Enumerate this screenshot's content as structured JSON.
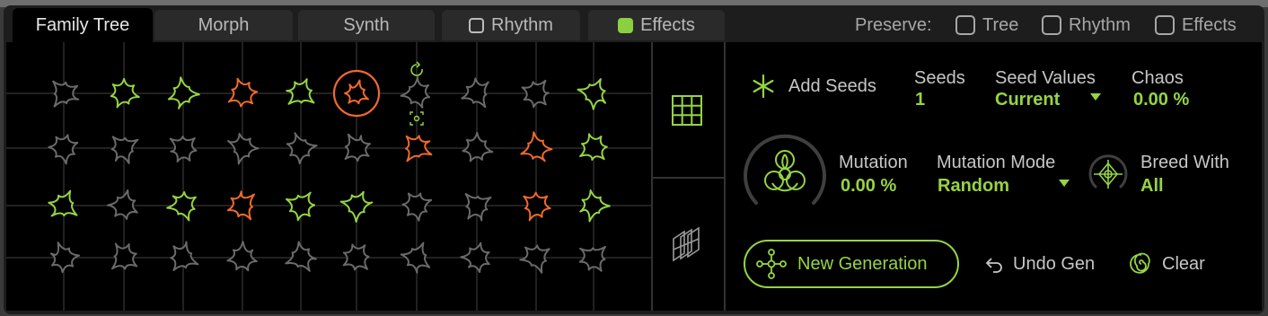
{
  "tabs": [
    {
      "label": "Family Tree",
      "active": true
    },
    {
      "label": "Morph",
      "active": false
    },
    {
      "label": "Synth",
      "active": false
    },
    {
      "label": "Rhythm",
      "active": false,
      "checkbox": false
    },
    {
      "label": "Effects",
      "active": false,
      "checkbox": true
    }
  ],
  "preserve": {
    "label": "Preserve:",
    "options": [
      {
        "label": "Tree",
        "checked": false
      },
      {
        "label": "Rhythm",
        "checked": false
      },
      {
        "label": "Effects",
        "checked": false
      }
    ]
  },
  "colors": {
    "accent": "#95d444",
    "highlight": "#f06a2d",
    "inactive": "#6a6a6a"
  },
  "tree": {
    "rows": [
      [
        "gray",
        "green",
        "green",
        "orange",
        "green",
        "selected",
        "gray",
        "gray",
        "gray",
        "green"
      ],
      [
        "gray",
        "gray",
        "gray",
        "gray",
        "gray",
        "gray",
        "orange",
        "gray",
        "orange",
        "green"
      ],
      [
        "green",
        "gray",
        "green",
        "orange",
        "green",
        "green",
        "gray",
        "gray",
        "orange",
        "green"
      ],
      [
        "gray",
        "gray",
        "gray",
        "gray",
        "gray",
        "gray",
        "gray",
        "gray",
        "gray",
        "gray"
      ]
    ]
  },
  "view_buttons": [
    {
      "icon": "grid-icon",
      "active": true
    },
    {
      "icon": "layers-icon",
      "active": false
    }
  ],
  "controls": {
    "add_seeds": "Add Seeds",
    "seeds_label": "Seeds",
    "seeds_value": "1",
    "seed_values_label": "Seed Values",
    "seed_values_value": "Current",
    "chaos_label": "Chaos",
    "chaos_value": "0.00 %",
    "mutation_label": "Mutation",
    "mutation_value": "0.00 %",
    "mutation_mode_label": "Mutation Mode",
    "mutation_mode_value": "Random",
    "breed_with_label": "Breed With",
    "breed_with_value": "All",
    "new_generation": "New Generation",
    "undo_gen": "Undo Gen",
    "clear": "Clear"
  }
}
